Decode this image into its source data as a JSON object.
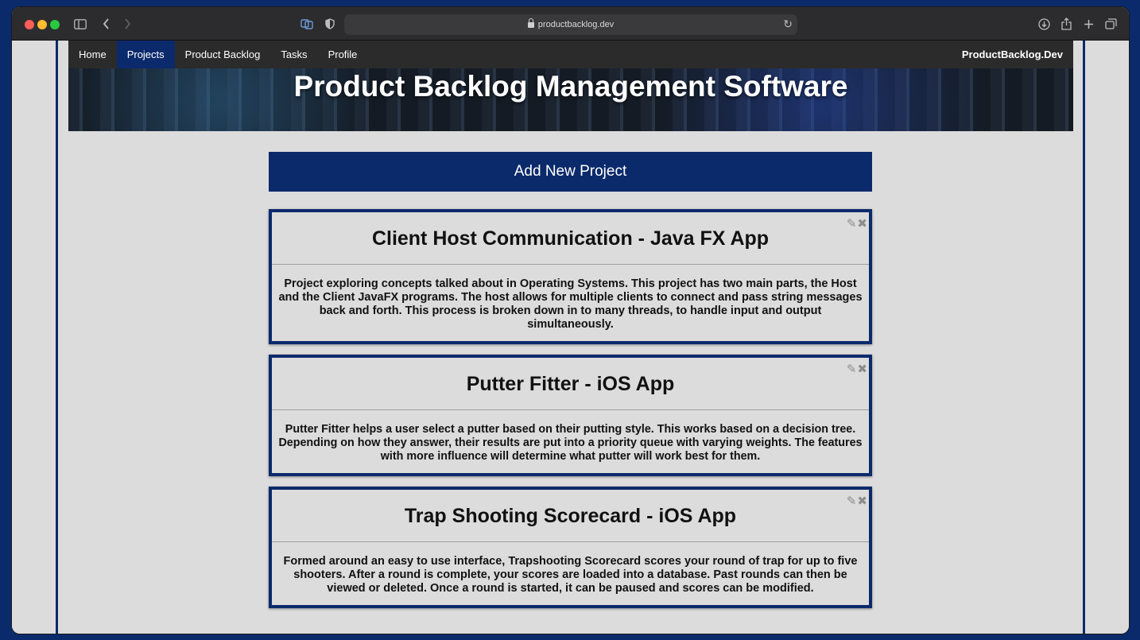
{
  "browser": {
    "url": "productbacklog.dev"
  },
  "nav": {
    "items": [
      {
        "label": "Home"
      },
      {
        "label": "Projects"
      },
      {
        "label": "Product Backlog"
      },
      {
        "label": "Tasks"
      },
      {
        "label": "Profile"
      }
    ],
    "active": "Projects",
    "brand": "ProductBacklog.Dev"
  },
  "hero": {
    "title": "Product Backlog Management Software"
  },
  "add_button": {
    "label": "Add New Project"
  },
  "projects": [
    {
      "title": "Client Host Communication - Java FX App",
      "description": "Project exploring concepts talked about in Operating Systems. This project has two main parts, the Host and the Client JavaFX programs. The host allows for multiple clients to connect and pass string messages back and forth. This process is broken down in to many threads, to handle input and output simultaneously."
    },
    {
      "title": "Putter Fitter - iOS App",
      "description": "Putter Fitter helps a user select a putter based on their putting style. This works based on a decision tree. Depending on how they answer, their results are put into a priority queue with varying weights. The features with more influence will determine what putter will work best for them."
    },
    {
      "title": "Trap Shooting Scorecard - iOS App",
      "description": "Formed around an easy to use interface, Trapshooting Scorecard scores your round of trap for up to five shooters. After a round is complete, your scores are loaded into a database. Past rounds can then be viewed or deleted. Once a round is started, it can be paused and scores can be modified."
    }
  ],
  "icons": {
    "edit": "pencil-icon",
    "delete": "close-icon"
  }
}
